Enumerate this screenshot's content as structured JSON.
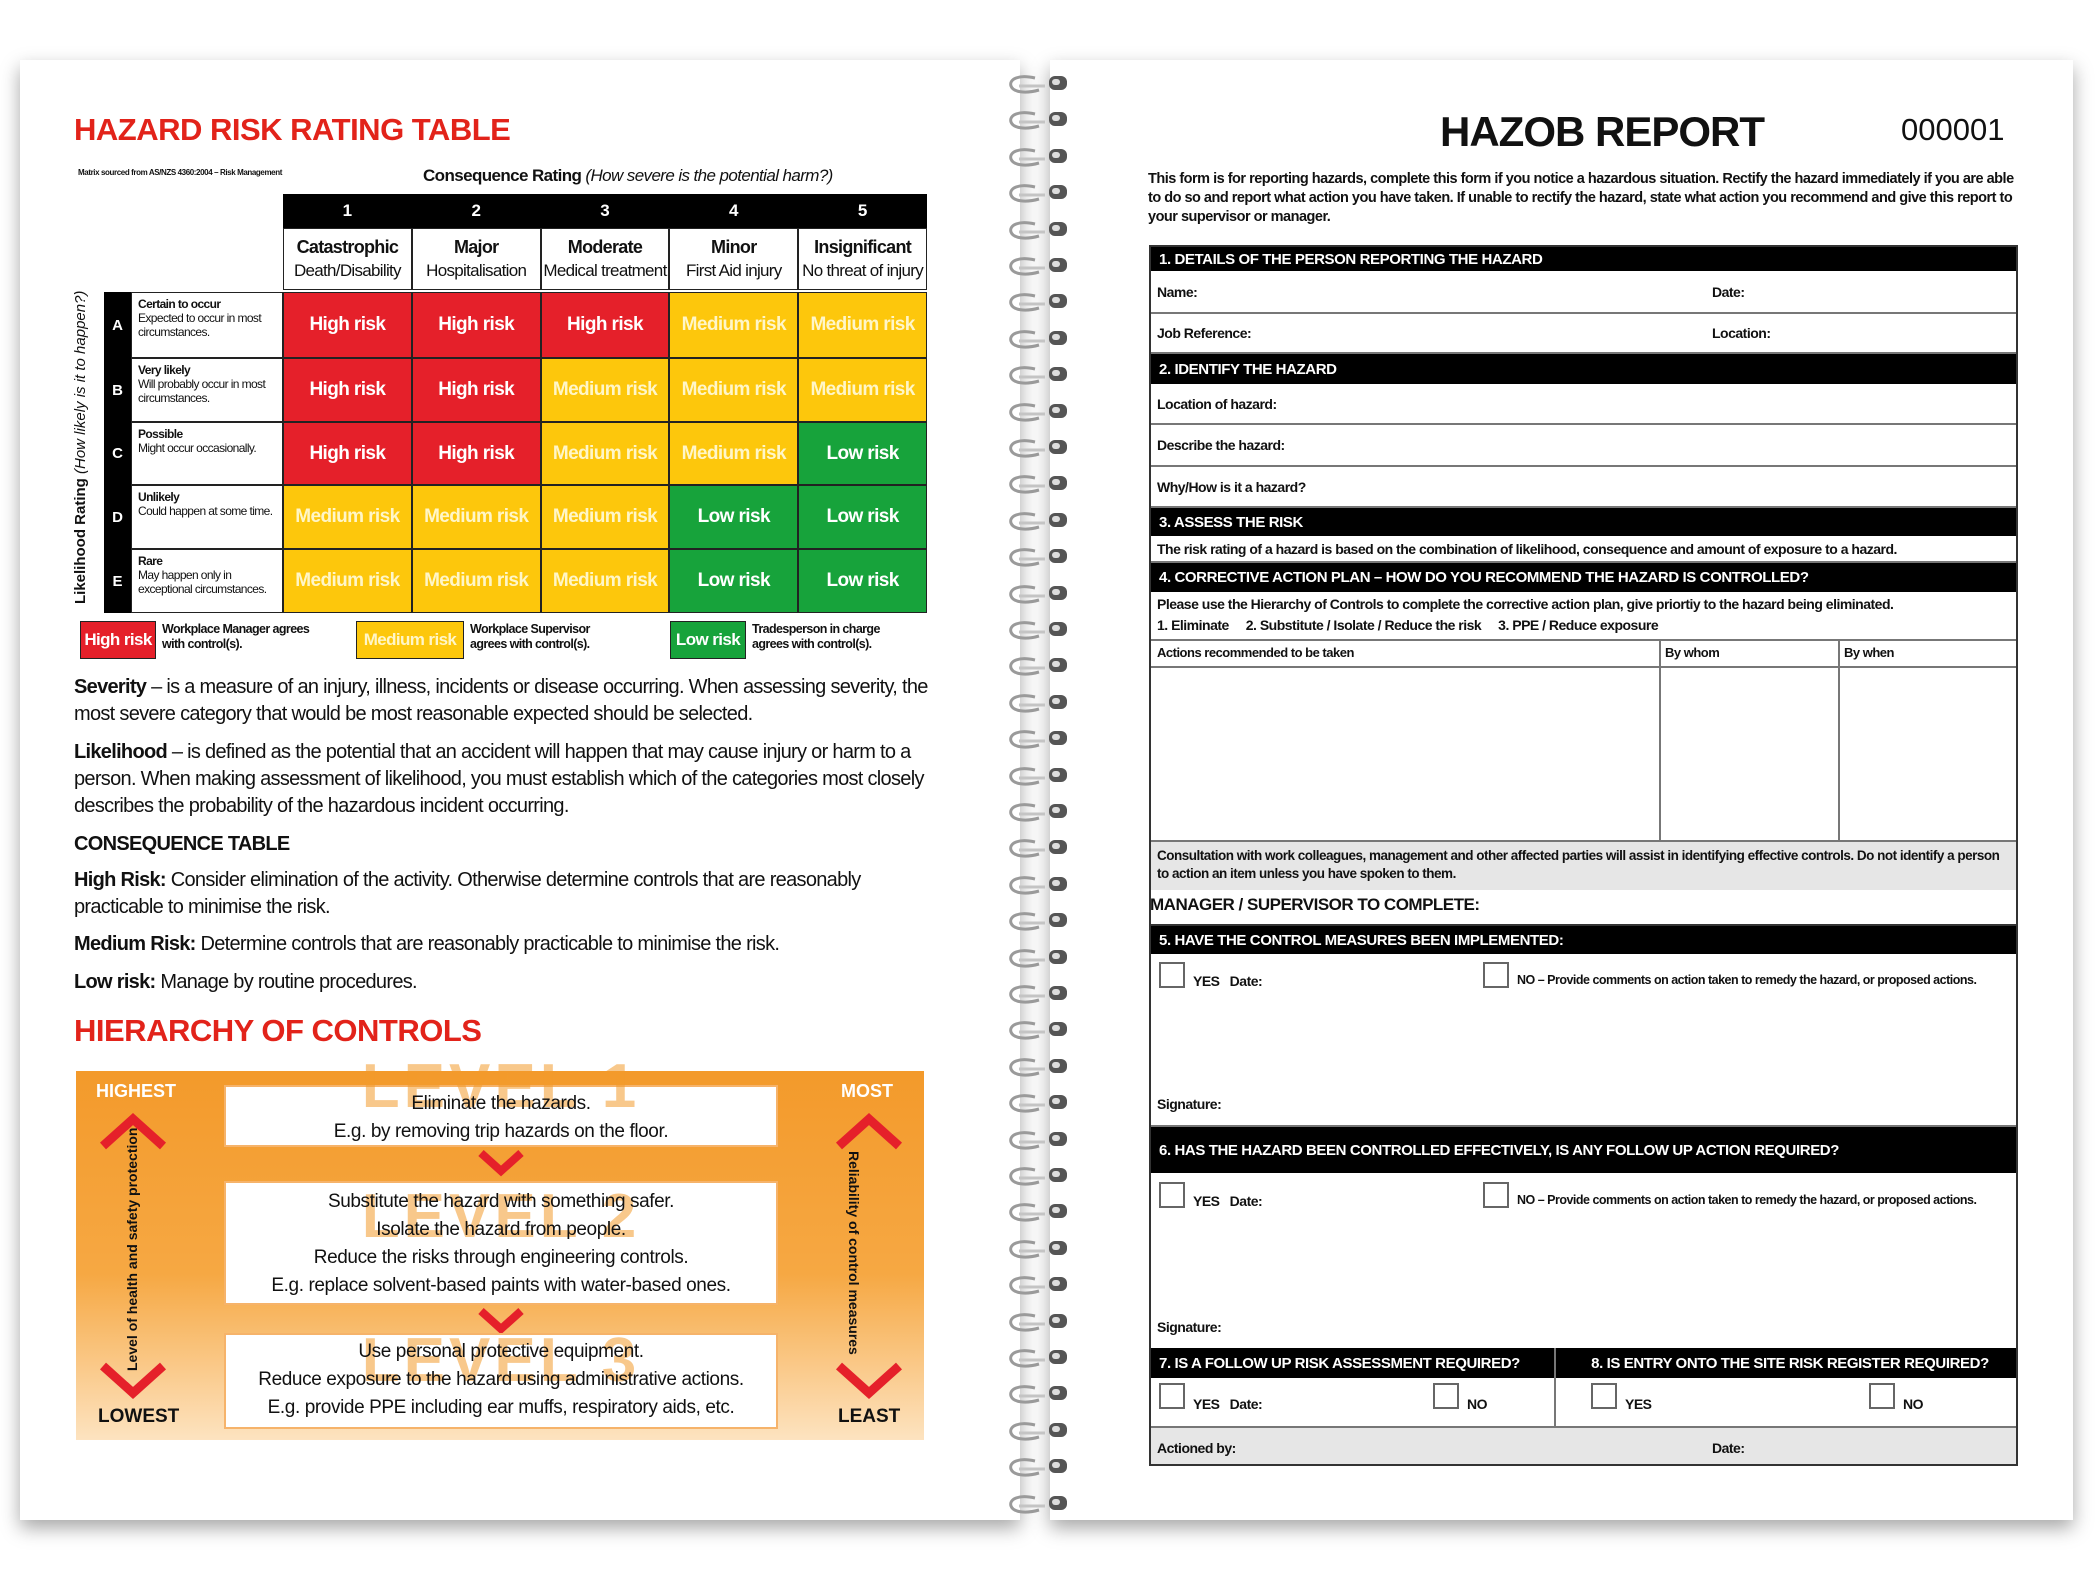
{
  "left": {
    "title": "HAZARD RISK RATING TABLE",
    "source_note": "Matrix sourced from AS/NZS 4360:2004 – Risk Management",
    "consequence_label": "Consequence Rating",
    "consequence_question": "(How severe is the potential harm?)",
    "likelihood_label": "Likelihood Rating",
    "likelihood_question": "(How likely is it to happen?)",
    "columns": [
      {
        "num": "1",
        "title": "Catastrophic",
        "desc": "Death/Disability"
      },
      {
        "num": "2",
        "title": "Major",
        "desc": "Hospitalisation"
      },
      {
        "num": "3",
        "title": "Moderate",
        "desc": "Medical treatment"
      },
      {
        "num": "4",
        "title": "Minor",
        "desc": "First Aid injury"
      },
      {
        "num": "5",
        "title": "Insignificant",
        "desc": "No threat of injury"
      }
    ],
    "rows": [
      {
        "letter": "A",
        "title": "Certain to occur",
        "desc": "Expected to occur in most circumstances.",
        "cells": [
          "high",
          "high",
          "high",
          "medium",
          "medium"
        ]
      },
      {
        "letter": "B",
        "title": "Very likely",
        "desc": "Will probably occur in most circumstances.",
        "cells": [
          "high",
          "high",
          "medium",
          "medium",
          "medium"
        ]
      },
      {
        "letter": "C",
        "title": "Possible",
        "desc": "Might occur occasionally.",
        "cells": [
          "high",
          "high",
          "medium",
          "medium",
          "low"
        ]
      },
      {
        "letter": "D",
        "title": "Unlikely",
        "desc": "Could happen at some time.",
        "cells": [
          "medium",
          "medium",
          "medium",
          "low",
          "low"
        ]
      },
      {
        "letter": "E",
        "title": "Rare",
        "desc": "May happen only in exceptional circumstances.",
        "cells": [
          "medium",
          "medium",
          "medium",
          "low",
          "low"
        ]
      }
    ],
    "risk_labels": {
      "high": "High risk",
      "medium": "Medium risk",
      "low": "Low risk"
    },
    "colors": {
      "high": "#e5202a",
      "medium": "#fdc70c",
      "low": "#17a33b",
      "title_red": "#e2231a",
      "orange": "#f39a2b"
    },
    "legend": [
      {
        "level": "high",
        "text": "Workplace Manager agrees with control(s)."
      },
      {
        "level": "medium",
        "text": "Workplace Supervisor agrees with control(s)."
      },
      {
        "level": "low",
        "text": "Tradesperson in charge agrees with control(s)."
      }
    ],
    "severity_term": "Severity",
    "severity_text": " – is a measure of an injury, illness, incidents or disease occurring. When assessing severity, the most severe category that would be most reasonable expected should be selected.",
    "likelihood_term": "Likelihood",
    "likelihood_text": " – is defined as the potential that an accident will happen that may cause injury or harm to a person. When making assessment of likelihood, you must establish which of the categories most closely describes the probability of the hazardous incident occurring.",
    "consequence_table_heading": "CONSEQUENCE TABLE",
    "high_term": "High Risk:",
    "high_text": " Consider elimination of the activity. Otherwise determine controls that are reasonably practicable to minimise the risk.",
    "medium_term": "Medium Risk:",
    "medium_text": " Determine controls that are reasonably practicable to minimise the risk.",
    "low_term": "Low risk:",
    "low_text": " Manage by routine procedures.",
    "hierarchy_title": "HIERARCHY OF CONTROLS",
    "hierarchy": {
      "left_top": "HIGHEST",
      "left_bottom": "LOWEST",
      "left_axis": "Level of health and safety protection",
      "right_top": "MOST",
      "right_bottom": "LEAST",
      "right_axis": "Reliability of control measures",
      "levels": [
        {
          "ghost": "LEVEL 1",
          "lines": [
            "Eliminate the hazards.",
            "E.g. by removing trip hazards on the floor."
          ]
        },
        {
          "ghost": "LEVEL 2",
          "lines": [
            "Substitute the hazard with something safer.",
            "Isolate the hazard from people.",
            "Reduce the risks through engineering controls.",
            "E.g. replace solvent-based paints with water-based ones."
          ]
        },
        {
          "ghost": "LEVEL 3",
          "lines": [
            "Use personal protective equipment.",
            "Reduce exposure to the hazard using administrative actions.",
            "E.g. provide PPE including ear muffs, respiratory aids, etc."
          ]
        }
      ]
    }
  },
  "right": {
    "title": "HAZOB REPORT",
    "serial": "000001",
    "intro": "This form is for reporting hazards, complete this form if you notice a hazardous situation. Rectify the hazard immediately if you are able to do so and report what action you have taken. If unable to rectify the hazard, state what action you recommend and give this report to your supervisor or manager.",
    "s1": "1. DETAILS OF THE PERSON REPORTING THE HAZARD",
    "name": "Name:",
    "date": "Date:",
    "job_ref": "Job Reference:",
    "location": "Location:",
    "s2": "2. IDENTIFY THE HAZARD",
    "loc_hazard": "Location of hazard:",
    "describe": "Describe the hazard:",
    "why": "Why/How is it a hazard?",
    "s3": "3. ASSESS THE RISK",
    "s3_text": "The risk rating of a hazard is based on the combination of likelihood, consequence and amount of exposure to a hazard.",
    "s4": "4. CORRECTIVE ACTION PLAN – HOW DO YOU RECOMMEND THE HAZARD IS CONTROLLED?",
    "s4_text": "Please use the Hierarchy of Controls to complete the corrective action plan, give priortiy to the hazard being eliminated.",
    "s4_steps": "1. Eliminate     2. Substitute / Isolate / Reduce the risk     3. PPE / Reduce exposure",
    "col_actions": "Actions recommended to be taken",
    "col_whom": "By whom",
    "col_when": "By when",
    "consultation": "Consultation with work colleagues, management and other affected parties will assist in identifying effective controls. Do not identify a person to action an item unless you have spoken to them.",
    "manager": "MANAGER / SUPERVISOR TO COMPLETE:",
    "s5": "5. HAVE THE CONTROL MEASURES BEEN IMPLEMENTED:",
    "yes_date": "YES   Date:",
    "no_comments": "NO – Provide comments on action taken to remedy the hazard, or proposed actions.",
    "signature": "Signature:",
    "s6": "6. HAS THE HAZARD BEEN CONTROLLED EFFECTIVELY, IS ANY FOLLOW UP ACTION REQUIRED?",
    "s7": "7. IS A FOLLOW UP RISK ASSESSMENT REQUIRED?",
    "s8": "8. IS ENTRY ONTO THE SITE RISK REGISTER REQUIRED?",
    "yes": "YES",
    "no": "NO",
    "actioned_by": "Actioned by:"
  }
}
